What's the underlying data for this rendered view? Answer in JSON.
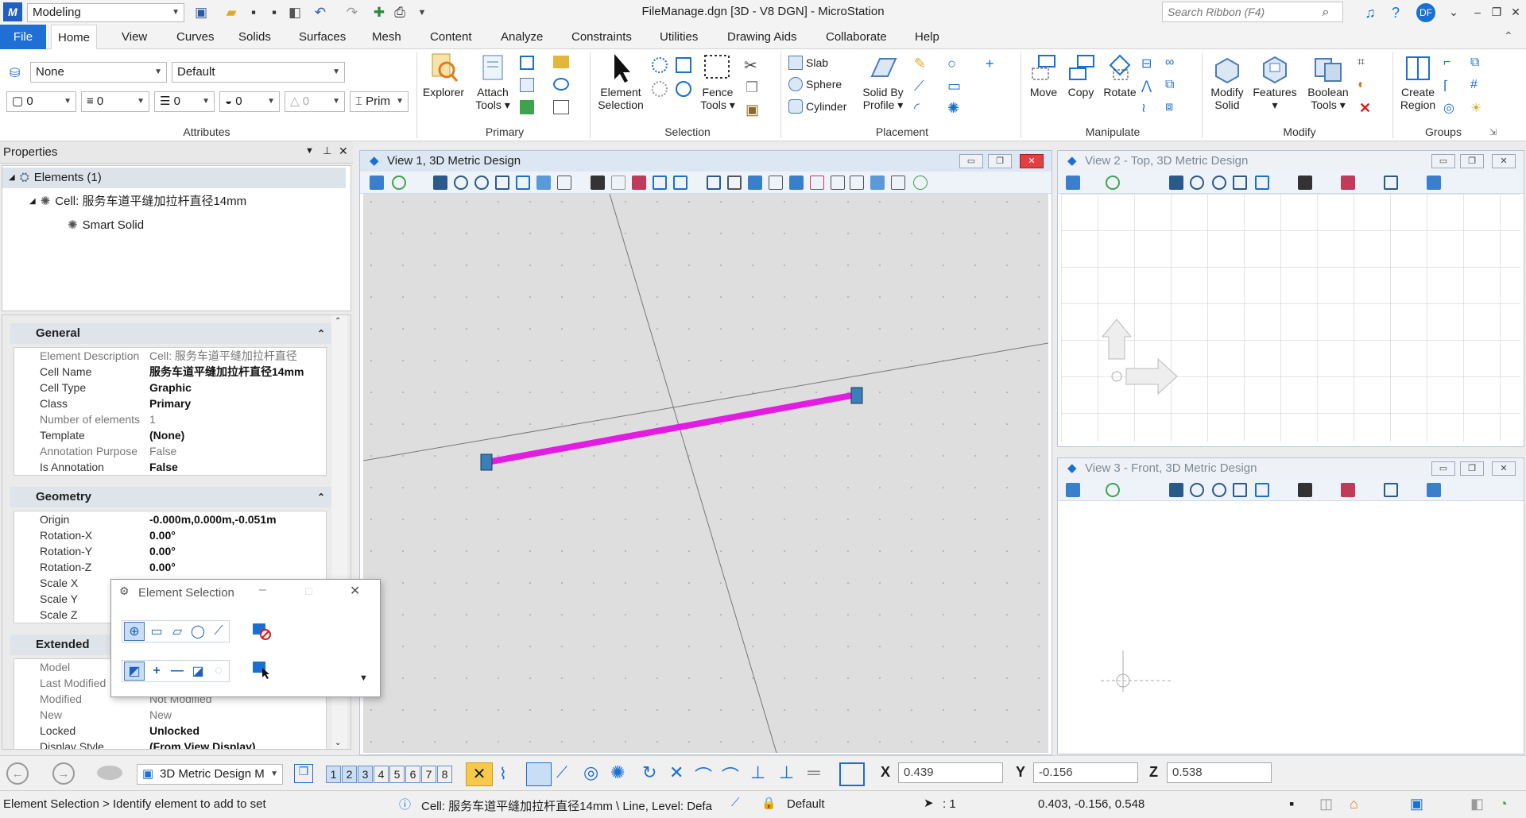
{
  "titlebar": {
    "workflow": "Modeling",
    "title": "FileManage.dgn [3D - V8 DGN] - MicroStation",
    "search_placeholder": "Search Ribbon (F4)",
    "user_initials": "DF"
  },
  "tabs": [
    "File",
    "Home",
    "View",
    "Curves",
    "Solids",
    "Surfaces",
    "Mesh",
    "Content",
    "Analyze",
    "Constraints",
    "Utilities",
    "Drawing Aids",
    "Collaborate",
    "Help"
  ],
  "active_tab": "Home",
  "ribbon": {
    "attributes": {
      "level": "None",
      "style": "Default",
      "color": "0",
      "line_style": "0",
      "weight": "0",
      "transparency": "0",
      "priority": "0",
      "prim": "Prim",
      "label": "Attributes"
    },
    "primary": {
      "explorer": "Explorer",
      "attach": "Attach",
      "attach2": "Tools",
      "label": "Primary"
    },
    "selection": {
      "element_selection": "Element",
      "element_selection2": "Selection",
      "fence": "Fence",
      "fence2": "Tools",
      "label": "Selection"
    },
    "placement": {
      "slab": "Slab",
      "sphere": "Sphere",
      "cylinder": "Cylinder",
      "solid_by": "Solid By",
      "profile": "Profile",
      "label": "Placement"
    },
    "manipulate": {
      "move": "Move",
      "copy": "Copy",
      "rotate": "Rotate",
      "label": "Manipulate"
    },
    "modify": {
      "modify_solid": "Modify",
      "modify_solid2": "Solid",
      "features": "Features",
      "boolean": "Boolean",
      "boolean2": "Tools",
      "label": "Modify"
    },
    "groups": {
      "create_region": "Create",
      "create_region2": "Region",
      "label": "Groups"
    }
  },
  "properties": {
    "title": "Properties",
    "tree": {
      "root": "Elements (1)",
      "cell": "Cell: 服务车道平缝加拉杆直径14mm",
      "child": "Smart Solid"
    },
    "general": {
      "title": "General",
      "rows": [
        {
          "k": "Element Description",
          "v": "Cell: 服务车道平缝加拉杆直径",
          "dim": true
        },
        {
          "k": "Cell Name",
          "v": "服务车道平缝加拉杆直径14mm",
          "dim": false
        },
        {
          "k": "Cell Type",
          "v": "Graphic",
          "dim": false
        },
        {
          "k": "Class",
          "v": "Primary",
          "dim": false
        },
        {
          "k": "Number of elements",
          "v": "1",
          "dim": true
        },
        {
          "k": "Template",
          "v": "(None)",
          "dim": false
        },
        {
          "k": "Annotation Purpose",
          "v": "False",
          "dim": true
        },
        {
          "k": "Is Annotation",
          "v": "False",
          "dim": false
        }
      ]
    },
    "geometry": {
      "title": "Geometry",
      "rows": [
        {
          "k": "Origin",
          "v": "-0.000m,0.000m,-0.051m",
          "dim": false
        },
        {
          "k": "Rotation-X",
          "v": "0.00°",
          "dim": false
        },
        {
          "k": "Rotation-Y",
          "v": "0.00°",
          "dim": false
        },
        {
          "k": "Rotation-Z",
          "v": "0.00°",
          "dim": false
        },
        {
          "k": "Scale X",
          "v": "",
          "dim": false
        },
        {
          "k": "Scale Y",
          "v": "",
          "dim": false
        },
        {
          "k": "Scale Z",
          "v": "",
          "dim": false
        }
      ]
    },
    "extended": {
      "title": "Extended",
      "rows": [
        {
          "k": "Model",
          "v": "",
          "dim": true
        },
        {
          "k": "Last Modified",
          "v": "",
          "dim": true
        },
        {
          "k": "Modified",
          "v": "Not Modified",
          "dim": true
        },
        {
          "k": "New",
          "v": "New",
          "dim": true
        },
        {
          "k": "Locked",
          "v": "Unlocked",
          "dim": false
        },
        {
          "k": "Display Style",
          "v": "(From View Display)",
          "dim": false
        }
      ]
    }
  },
  "views": {
    "v1": "View 1, 3D Metric Design",
    "v2": "View 2 - Top, 3D Metric Design",
    "v3": "View 3 - Front, 3D Metric Design"
  },
  "element_selection": {
    "title": "Element Selection"
  },
  "bottom": {
    "view_model": "3D Metric Design M",
    "view_numbers": [
      "1",
      "2",
      "3",
      "4",
      "5",
      "6",
      "7",
      "8"
    ],
    "x_label": "X",
    "x_val": "0.439",
    "y_label": "Y",
    "y_val": "-0.156",
    "z_label": "Z",
    "z_val": "0.538"
  },
  "status": {
    "prompt": "Element Selection > Identify element to add to set",
    "info": "Cell: 服务车道平缝加拉杆直径14mm \\ Line, Level: Defa",
    "level": "Default",
    "selection_count": ": 1",
    "coords": "0.403, -0.156, 0.548"
  },
  "colors": {
    "accent": "#1f6fd4",
    "bar": "#e21ce0",
    "handle": "#3a7fb8"
  }
}
